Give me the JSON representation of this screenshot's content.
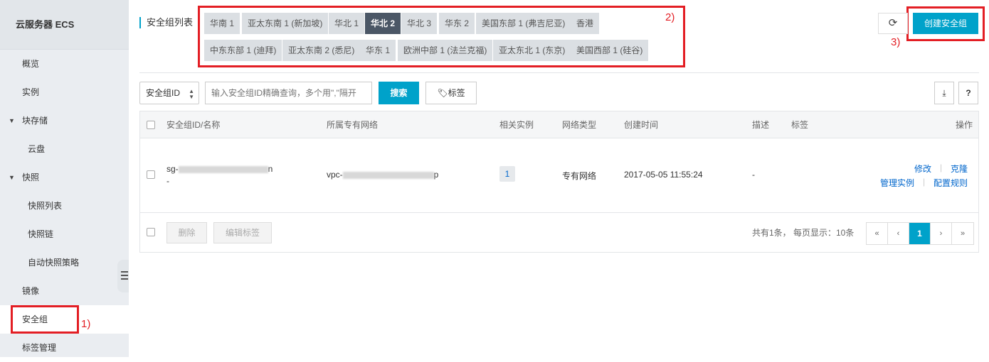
{
  "sidebar": {
    "title": "云服务器 ECS",
    "items": [
      {
        "label": "概览"
      },
      {
        "label": "实例"
      },
      {
        "label": "块存储"
      },
      {
        "label": "云盘"
      },
      {
        "label": "快照"
      },
      {
        "label": "快照列表"
      },
      {
        "label": "快照链"
      },
      {
        "label": "自动快照策略"
      },
      {
        "label": "镜像"
      },
      {
        "label": "安全组"
      },
      {
        "label": "标签管理"
      }
    ]
  },
  "annotations": {
    "one": "1)",
    "two": "2)",
    "three": "3)"
  },
  "header": {
    "title": "安全组列表",
    "regions_row1": [
      "华南 1",
      "亚太东南 1 (新加坡)",
      "华北 1",
      "华北 2",
      "华北 3",
      "华东 2",
      "美国东部 1 (弗吉尼亚)",
      "香港"
    ],
    "regions_row2": [
      "中东东部 1 (迪拜)",
      "亚太东南 2 (悉尼)",
      "华东 1",
      "欧洲中部 1 (法兰克福)",
      "亚太东北 1 (东京)",
      "美国西部 1 (硅谷)"
    ],
    "active_region": "华北 2",
    "create_label": "创建安全组"
  },
  "search": {
    "select_value": "安全组ID",
    "placeholder": "输入安全组ID精确查询，多个用\",\"隔开",
    "search_label": "搜索",
    "tag_label": "标签",
    "help_label": "?"
  },
  "table": {
    "headers": [
      "安全组ID/名称",
      "所属专有网络",
      "相关实例",
      "网络类型",
      "创建时间",
      "描述",
      "标签",
      "操作"
    ],
    "rows": [
      {
        "id_prefix": "sg-",
        "id_suffix": "n",
        "name": "-",
        "vpc_prefix": "vpc-",
        "vpc_suffix": "p",
        "instances": "1",
        "network_type": "专有网络",
        "created": "2017-05-05 11:55:24",
        "description": "-",
        "actions": [
          "修改",
          "克隆",
          "管理实例",
          "配置规则"
        ]
      }
    ],
    "footer": {
      "delete_label": "删除",
      "edit_tags_label": "编辑标签",
      "summary": "共有1条， 每页显示：10条",
      "current_page": "1"
    }
  }
}
